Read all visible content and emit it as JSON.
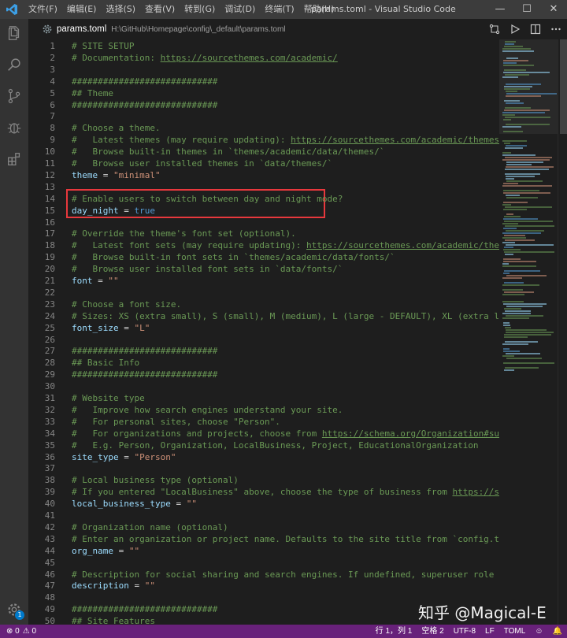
{
  "titlebar": {
    "menu": [
      "文件(F)",
      "编辑(E)",
      "选择(S)",
      "查看(V)",
      "转到(G)",
      "调试(D)",
      "终端(T)",
      "帮助(H)"
    ],
    "window_title": "params.toml - Visual Studio Code",
    "minimize": "—",
    "maximize": "☐",
    "close": "✕"
  },
  "tab": {
    "filename": "params.toml",
    "path": "H:\\GitHub\\Homepage\\config\\_default\\params.toml"
  },
  "activity": {
    "settings_badge": "1"
  },
  "editor": {
    "lines": [
      {
        "n": "1",
        "t": "# SITE SETUP"
      },
      {
        "n": "2",
        "t": "# Documentation: ",
        "url": "https://sourcethemes.com/academic/"
      },
      {
        "n": "3",
        "t": ""
      },
      {
        "n": "4",
        "t": "############################"
      },
      {
        "n": "5",
        "t": "## Theme"
      },
      {
        "n": "6",
        "t": "############################"
      },
      {
        "n": "7",
        "t": ""
      },
      {
        "n": "8",
        "t": "# Choose a theme."
      },
      {
        "n": "9",
        "t": "#   Latest themes (may require updating): ",
        "url": "https://sourcethemes.com/academic/themes/"
      },
      {
        "n": "10",
        "t": "#   Browse built-in themes in `themes/academic/data/themes/`"
      },
      {
        "n": "11",
        "t": "#   Browse user installed themes in `data/themes/`"
      },
      {
        "n": "12",
        "k": "theme",
        "v": "\"minimal\""
      },
      {
        "n": "13",
        "t": ""
      },
      {
        "n": "14",
        "t": "# Enable users to switch between day and night mode?"
      },
      {
        "n": "15",
        "k": "day_night",
        "b": "true"
      },
      {
        "n": "16",
        "t": ""
      },
      {
        "n": "17",
        "t": "# Override the theme's font set (optional)."
      },
      {
        "n": "18",
        "t": "#   Latest font sets (may require updating): ",
        "url": "https://sourcethemes.com/academic/themes/"
      },
      {
        "n": "19",
        "t": "#   Browse built-in font sets in `themes/academic/data/fonts/`"
      },
      {
        "n": "20",
        "t": "#   Browse user installed font sets in `data/fonts/`"
      },
      {
        "n": "21",
        "k": "font",
        "v": "\"\""
      },
      {
        "n": "22",
        "t": ""
      },
      {
        "n": "23",
        "t": "# Choose a font size."
      },
      {
        "n": "24",
        "t": "# Sizes: XS (extra small), S (small), M (medium), L (large - DEFAULT), XL (extra large)"
      },
      {
        "n": "25",
        "k": "font_size",
        "v": "\"L\""
      },
      {
        "n": "26",
        "t": ""
      },
      {
        "n": "27",
        "t": "############################"
      },
      {
        "n": "28",
        "t": "## Basic Info"
      },
      {
        "n": "29",
        "t": "############################"
      },
      {
        "n": "30",
        "t": ""
      },
      {
        "n": "31",
        "t": "# Website type"
      },
      {
        "n": "32",
        "t": "#   Improve how search engines understand your site."
      },
      {
        "n": "33",
        "t": "#   For personal sites, choose \"Person\"."
      },
      {
        "n": "34",
        "t": "#   For organizations and projects, choose from ",
        "url": "https://schema.org/Organization#subtypes"
      },
      {
        "n": "35",
        "t": "#   E.g. Person, Organization, LocalBusiness, Project, EducationalOrganization"
      },
      {
        "n": "36",
        "k": "site_type",
        "v": "\"Person\""
      },
      {
        "n": "37",
        "t": ""
      },
      {
        "n": "38",
        "t": "# Local business type (optional)"
      },
      {
        "n": "39",
        "t": "# If you entered \"LocalBusiness\" above, choose the type of business from ",
        "url": "https://schema.org"
      },
      {
        "n": "40",
        "k": "local_business_type",
        "v": "\"\""
      },
      {
        "n": "41",
        "t": ""
      },
      {
        "n": "42",
        "t": "# Organization name (optional)"
      },
      {
        "n": "43",
        "t": "# Enter an organization or project name. Defaults to the site title from `config.toml`."
      },
      {
        "n": "44",
        "k": "org_name",
        "v": "\"\""
      },
      {
        "n": "45",
        "t": ""
      },
      {
        "n": "46",
        "t": "# Description for social sharing and search engines. If undefined, superuser role is used i"
      },
      {
        "n": "47",
        "k": "description",
        "v": "\"\""
      },
      {
        "n": "48",
        "t": ""
      },
      {
        "n": "49",
        "t": "############################"
      },
      {
        "n": "50",
        "t": "## Site Features"
      }
    ]
  },
  "statusbar": {
    "errors": "⊗ 0",
    "warnings": "⚠ 0",
    "position": "行 1，列 1",
    "indent": "空格 2",
    "encoding": "UTF-8",
    "eol": "LF",
    "language": "TOML",
    "feedback": "☺",
    "bell": "🔔"
  },
  "watermark": "知乎 @Magical-E",
  "colors": {
    "comment": "#6a9955",
    "key": "#9cdcfe",
    "string": "#ce9178",
    "bool": "#569cd6",
    "statusbar": "#68217a",
    "highlight_box": "#e8383d"
  }
}
